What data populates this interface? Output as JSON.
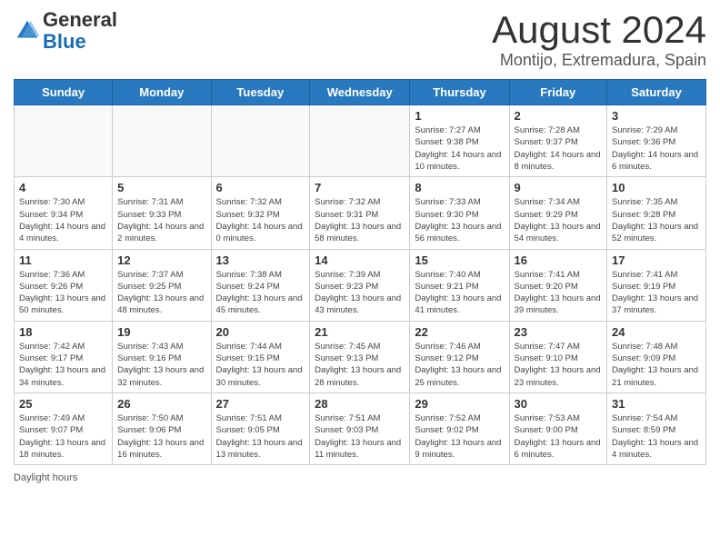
{
  "header": {
    "logo_line1": "General",
    "logo_line2": "Blue",
    "main_title": "August 2024",
    "subtitle": "Montijo, Extremadura, Spain"
  },
  "days_of_week": [
    "Sunday",
    "Monday",
    "Tuesday",
    "Wednesday",
    "Thursday",
    "Friday",
    "Saturday"
  ],
  "weeks": [
    [
      {
        "day": "",
        "info": ""
      },
      {
        "day": "",
        "info": ""
      },
      {
        "day": "",
        "info": ""
      },
      {
        "day": "",
        "info": ""
      },
      {
        "day": "1",
        "info": "Sunrise: 7:27 AM\nSunset: 9:38 PM\nDaylight: 14 hours and 10 minutes."
      },
      {
        "day": "2",
        "info": "Sunrise: 7:28 AM\nSunset: 9:37 PM\nDaylight: 14 hours and 8 minutes."
      },
      {
        "day": "3",
        "info": "Sunrise: 7:29 AM\nSunset: 9:36 PM\nDaylight: 14 hours and 6 minutes."
      }
    ],
    [
      {
        "day": "4",
        "info": "Sunrise: 7:30 AM\nSunset: 9:34 PM\nDaylight: 14 hours and 4 minutes."
      },
      {
        "day": "5",
        "info": "Sunrise: 7:31 AM\nSunset: 9:33 PM\nDaylight: 14 hours and 2 minutes."
      },
      {
        "day": "6",
        "info": "Sunrise: 7:32 AM\nSunset: 9:32 PM\nDaylight: 14 hours and 0 minutes."
      },
      {
        "day": "7",
        "info": "Sunrise: 7:32 AM\nSunset: 9:31 PM\nDaylight: 13 hours and 58 minutes."
      },
      {
        "day": "8",
        "info": "Sunrise: 7:33 AM\nSunset: 9:30 PM\nDaylight: 13 hours and 56 minutes."
      },
      {
        "day": "9",
        "info": "Sunrise: 7:34 AM\nSunset: 9:29 PM\nDaylight: 13 hours and 54 minutes."
      },
      {
        "day": "10",
        "info": "Sunrise: 7:35 AM\nSunset: 9:28 PM\nDaylight: 13 hours and 52 minutes."
      }
    ],
    [
      {
        "day": "11",
        "info": "Sunrise: 7:36 AM\nSunset: 9:26 PM\nDaylight: 13 hours and 50 minutes."
      },
      {
        "day": "12",
        "info": "Sunrise: 7:37 AM\nSunset: 9:25 PM\nDaylight: 13 hours and 48 minutes."
      },
      {
        "day": "13",
        "info": "Sunrise: 7:38 AM\nSunset: 9:24 PM\nDaylight: 13 hours and 45 minutes."
      },
      {
        "day": "14",
        "info": "Sunrise: 7:39 AM\nSunset: 9:23 PM\nDaylight: 13 hours and 43 minutes."
      },
      {
        "day": "15",
        "info": "Sunrise: 7:40 AM\nSunset: 9:21 PM\nDaylight: 13 hours and 41 minutes."
      },
      {
        "day": "16",
        "info": "Sunrise: 7:41 AM\nSunset: 9:20 PM\nDaylight: 13 hours and 39 minutes."
      },
      {
        "day": "17",
        "info": "Sunrise: 7:41 AM\nSunset: 9:19 PM\nDaylight: 13 hours and 37 minutes."
      }
    ],
    [
      {
        "day": "18",
        "info": "Sunrise: 7:42 AM\nSunset: 9:17 PM\nDaylight: 13 hours and 34 minutes."
      },
      {
        "day": "19",
        "info": "Sunrise: 7:43 AM\nSunset: 9:16 PM\nDaylight: 13 hours and 32 minutes."
      },
      {
        "day": "20",
        "info": "Sunrise: 7:44 AM\nSunset: 9:15 PM\nDaylight: 13 hours and 30 minutes."
      },
      {
        "day": "21",
        "info": "Sunrise: 7:45 AM\nSunset: 9:13 PM\nDaylight: 13 hours and 28 minutes."
      },
      {
        "day": "22",
        "info": "Sunrise: 7:46 AM\nSunset: 9:12 PM\nDaylight: 13 hours and 25 minutes."
      },
      {
        "day": "23",
        "info": "Sunrise: 7:47 AM\nSunset: 9:10 PM\nDaylight: 13 hours and 23 minutes."
      },
      {
        "day": "24",
        "info": "Sunrise: 7:48 AM\nSunset: 9:09 PM\nDaylight: 13 hours and 21 minutes."
      }
    ],
    [
      {
        "day": "25",
        "info": "Sunrise: 7:49 AM\nSunset: 9:07 PM\nDaylight: 13 hours and 18 minutes."
      },
      {
        "day": "26",
        "info": "Sunrise: 7:50 AM\nSunset: 9:06 PM\nDaylight: 13 hours and 16 minutes."
      },
      {
        "day": "27",
        "info": "Sunrise: 7:51 AM\nSunset: 9:05 PM\nDaylight: 13 hours and 13 minutes."
      },
      {
        "day": "28",
        "info": "Sunrise: 7:51 AM\nSunset: 9:03 PM\nDaylight: 13 hours and 11 minutes."
      },
      {
        "day": "29",
        "info": "Sunrise: 7:52 AM\nSunset: 9:02 PM\nDaylight: 13 hours and 9 minutes."
      },
      {
        "day": "30",
        "info": "Sunrise: 7:53 AM\nSunset: 9:00 PM\nDaylight: 13 hours and 6 minutes."
      },
      {
        "day": "31",
        "info": "Sunrise: 7:54 AM\nSunset: 8:59 PM\nDaylight: 13 hours and 4 minutes."
      }
    ]
  ],
  "footer": {
    "daylight_label": "Daylight hours"
  }
}
